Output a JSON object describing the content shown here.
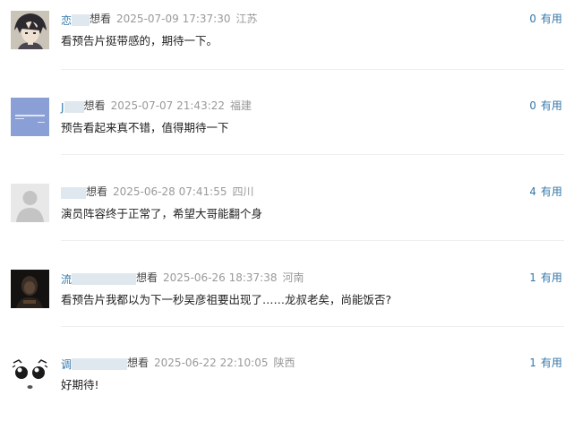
{
  "comments": [
    {
      "user": "恋",
      "status": "想看",
      "time": "2025-07-09 17:37:30",
      "location": "江苏",
      "text": "看预告片挺带感的，期待一下。",
      "votes": "0",
      "useful_label": "有用",
      "avatar_icon": "anime-character-avatar"
    },
    {
      "user": "J",
      "status": "想看",
      "time": "2025-07-07 21:43:22",
      "location": "福建",
      "text": "预告看起来真不错，值得期待一下",
      "votes": "0",
      "useful_label": "有用",
      "avatar_icon": "blue-text-avatar"
    },
    {
      "user": "",
      "status": "想看",
      "time": "2025-06-28 07:41:55",
      "location": "四川",
      "text": "演员阵容终于正常了，希望大哥能翻个身",
      "votes": "4",
      "useful_label": "有用",
      "avatar_icon": "default-user-avatar"
    },
    {
      "user": "流",
      "status": "想看",
      "time": "2025-06-26 18:37:38",
      "location": "河南",
      "text": "看预告片我都以为下一秒吴彦祖要出现了……龙叔老矣，尚能饭否?",
      "votes": "1",
      "useful_label": "有用",
      "avatar_icon": "dark-portrait-avatar"
    },
    {
      "user": "调",
      "status": "想看",
      "time": "2025-06-22 22:10:05",
      "location": "陕西",
      "text": "好期待!",
      "votes": "1",
      "useful_label": "有用",
      "avatar_icon": "cartoon-face-avatar"
    }
  ],
  "colors": {
    "link": "#3377aa",
    "meta": "#999999",
    "divider": "#eeeeee"
  }
}
